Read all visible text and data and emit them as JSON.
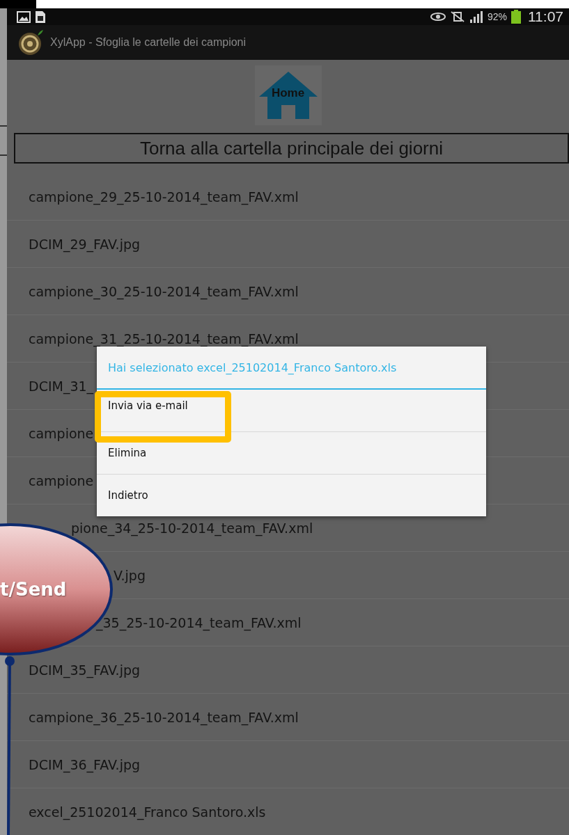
{
  "status_bar": {
    "battery": "92%",
    "time": "11:07"
  },
  "app_bar": {
    "title": "XylApp - Sfoglia le cartelle dei campioni"
  },
  "home_button": {
    "label": "Home"
  },
  "back_button": {
    "label": "Torna alla cartella principale dei giorni"
  },
  "files": [
    {
      "name": "campione_29_25-10-2014_team_FAV.xml"
    },
    {
      "name": "DCIM_29_FAV.jpg"
    },
    {
      "name": "campione_30_25-10-2014_team_FAV.xml"
    },
    {
      "name": "campione_31_25-10-2014_team_FAV.xml"
    },
    {
      "name": "DCIM_31_"
    },
    {
      "name": "campione"
    },
    {
      "name": "campione"
    },
    {
      "name": "pione_34_25-10-2014_team_FAV.xml"
    },
    {
      "name": "V.jpg"
    },
    {
      "name": "_35_25-10-2014_team_FAV.xml"
    },
    {
      "name": "DCIM_35_FAV.jpg"
    },
    {
      "name": "campione_36_25-10-2014_team_FAV.xml"
    },
    {
      "name": "DCIM_36_FAV.jpg"
    },
    {
      "name": "excel_25102014_Franco Santoro.xls"
    }
  ],
  "dialog": {
    "title": "Hai selezionato excel_25102014_Franco Santoro.xls",
    "items": [
      {
        "label": "Invia via e-mail",
        "highlighted": true
      },
      {
        "label": "Elimina",
        "highlighted": false
      },
      {
        "label": "Indietro",
        "highlighted": false
      }
    ]
  },
  "callout": {
    "text": "t/Send"
  }
}
